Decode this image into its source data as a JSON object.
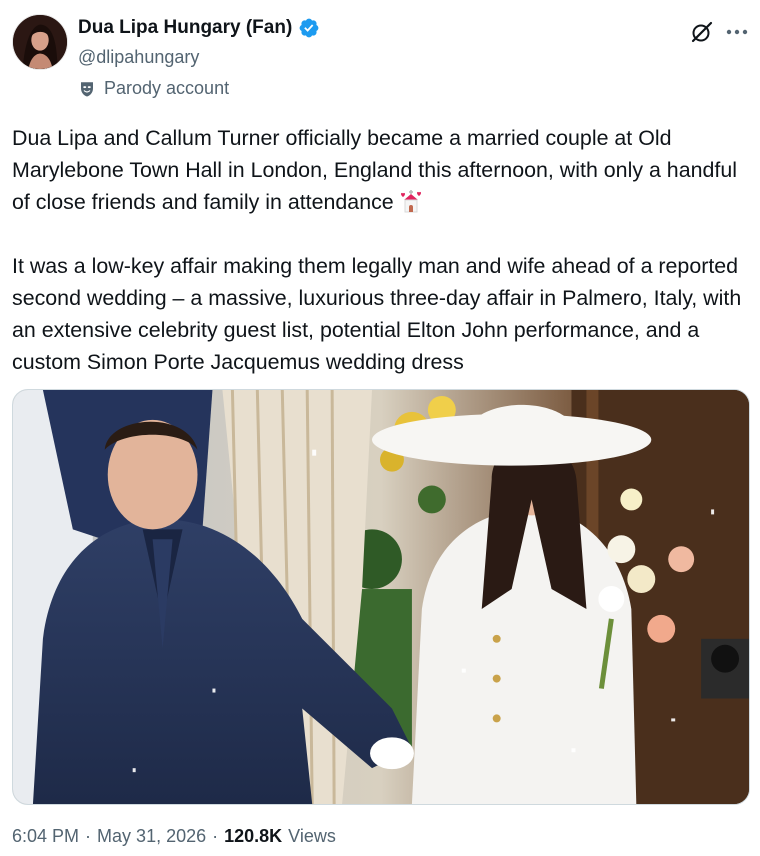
{
  "author": {
    "display_name": "Dua Lipa Hungary (Fan)",
    "handle": "@dlipahungary",
    "badge": "verified-badge",
    "label": "Parody account"
  },
  "tweet": {
    "paragraph_1": "Dua Lipa and Callum Turner officially became a married couple at Old Marylebone Town Hall in London, England this afternoon, with only a handful of close friends and family in attendance",
    "paragraph_1_emoji": "wedding-chapel-emoji",
    "paragraph_2": "It was a low-key affair making them legally man and wife ahead of a reported second wedding – a massive, luxurious three-day affair in Palmero, Italy, with an extensive celebrity guest list, potential Elton John performance, and a custom Simon Porte Jacquemus wedding dress"
  },
  "media": {
    "type": "photo",
    "icon": "wedding-photo"
  },
  "meta": {
    "time": "6:04 PM",
    "separator_1": "·",
    "date": "May 31, 2026",
    "separator_2": "·",
    "views_count": "120.8K",
    "views_label": "Views"
  },
  "icons": {
    "grok": "grok-icon",
    "more": "more-icon",
    "parody": "parody-mask-icon"
  },
  "colors": {
    "text_primary": "#0f1419",
    "text_secondary": "#536471",
    "verified_blue": "#1d9bf0",
    "border": "#cfd9de"
  }
}
